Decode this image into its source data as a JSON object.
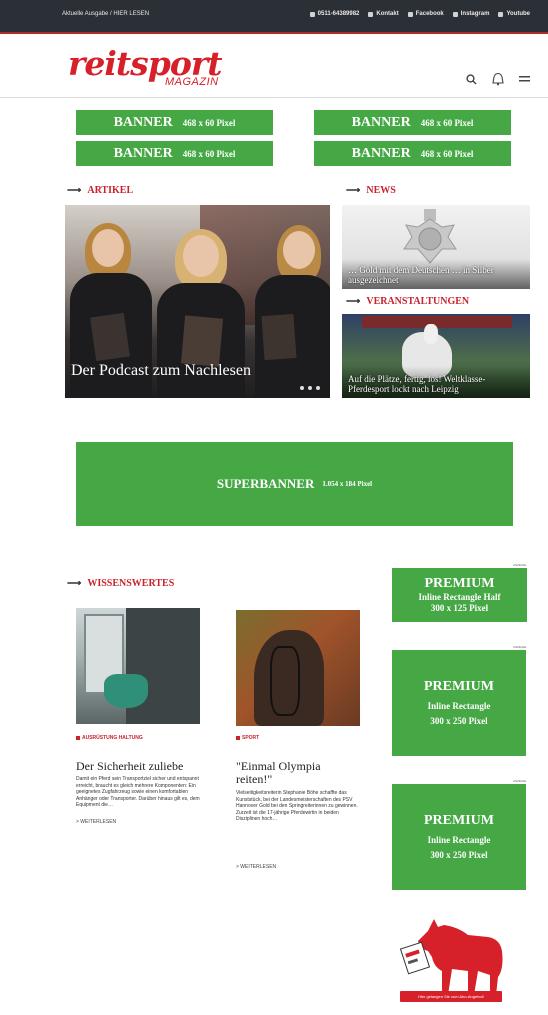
{
  "topbar": {
    "left": "Aktuelle Ausgabe / HIER LESEN",
    "phone": "0511-64389982",
    "kontakt": "Kontakt",
    "facebook": "Facebook",
    "instagram": "Instagram",
    "youtube": "Youtube"
  },
  "header": {
    "logo_main": "reitsport",
    "logo_sub": "MAGAZIN",
    "icons": [
      "search-icon",
      "bell-icon",
      "menu-icon"
    ]
  },
  "banners": [
    {
      "big": "BANNER",
      "small": "468 x 60 Pixel"
    },
    {
      "big": "BANNER",
      "small": "468 x 60 Pixel"
    },
    {
      "big": "BANNER",
      "small": "468 x 60 Pixel"
    },
    {
      "big": "BANNER",
      "small": "468 x 60 Pixel"
    }
  ],
  "sections": {
    "artikel": "ARTIKEL",
    "news": "NEWS",
    "veranstaltungen": "VERANSTALTUNGEN",
    "wissenswertes": "WISSENSWERTES"
  },
  "hero": {
    "caption": "Der Podcast zum Nachlesen"
  },
  "news": {
    "caption": "… Gold mit dem Deutschen … in Silber ausgezeichnet"
  },
  "event": {
    "caption": "Auf die Plätze, fertig, los! Weltklasse-Pferdesport lockt nach Leipzig"
  },
  "superbanner": {
    "big": "SUPERBANNER",
    "small": "1.054 x 184 Pixel"
  },
  "cards": [
    {
      "category": "AUSRÜSTUNG HALTUNG",
      "title": "Der Sicherheit zuliebe",
      "text": "Damit ein Pferd sein Transportziel sicher und entspannt erreicht, braucht es gleich mehrere Komponenten: Ein geeignetes Zugfahrzeug sowie einen komfortablen Anhänger oder Transporter. Darüber hinaus gilt es, dem Equipment die…",
      "more": "> WEITERLESEN"
    },
    {
      "category": "SPORT",
      "title": "\"Einmal Olympia reiten!\"",
      "text": "Vielseitigkeitsreiterin Stephanie Böhe schaffte das Kunststück, bei der Landesmeisterschaften des PSV Hannover Gold bei den Springreiterinnen zu gewinnen. Zurzeit ist die 17-jährige Pferdewirtin in beiden Disziplinen hoch…",
      "more": "> WEITERLESEN"
    }
  ],
  "premium": [
    {
      "p1": "PREMIUM",
      "p2": "Inline Rectangle Half",
      "p3": "300 x 125 Pixel",
      "anzeige": "ANZEIGE"
    },
    {
      "p1": "PREMIUM",
      "p2": "Inline Rectangle",
      "p3": "300 x 250 Pixel",
      "anzeige": "ANZEIGE"
    },
    {
      "p1": "PREMIUM",
      "p2": "Inline Rectangle",
      "p3": "300 x 250 Pixel",
      "anzeige": "ANZEIGE"
    }
  ],
  "horse_ad": {
    "button": "Hier gelangen Sie zum Abo-Angebot!"
  },
  "colors": {
    "brand_red": "#d6202a",
    "ad_green": "#45a845",
    "topbar": "#2b2f36"
  }
}
